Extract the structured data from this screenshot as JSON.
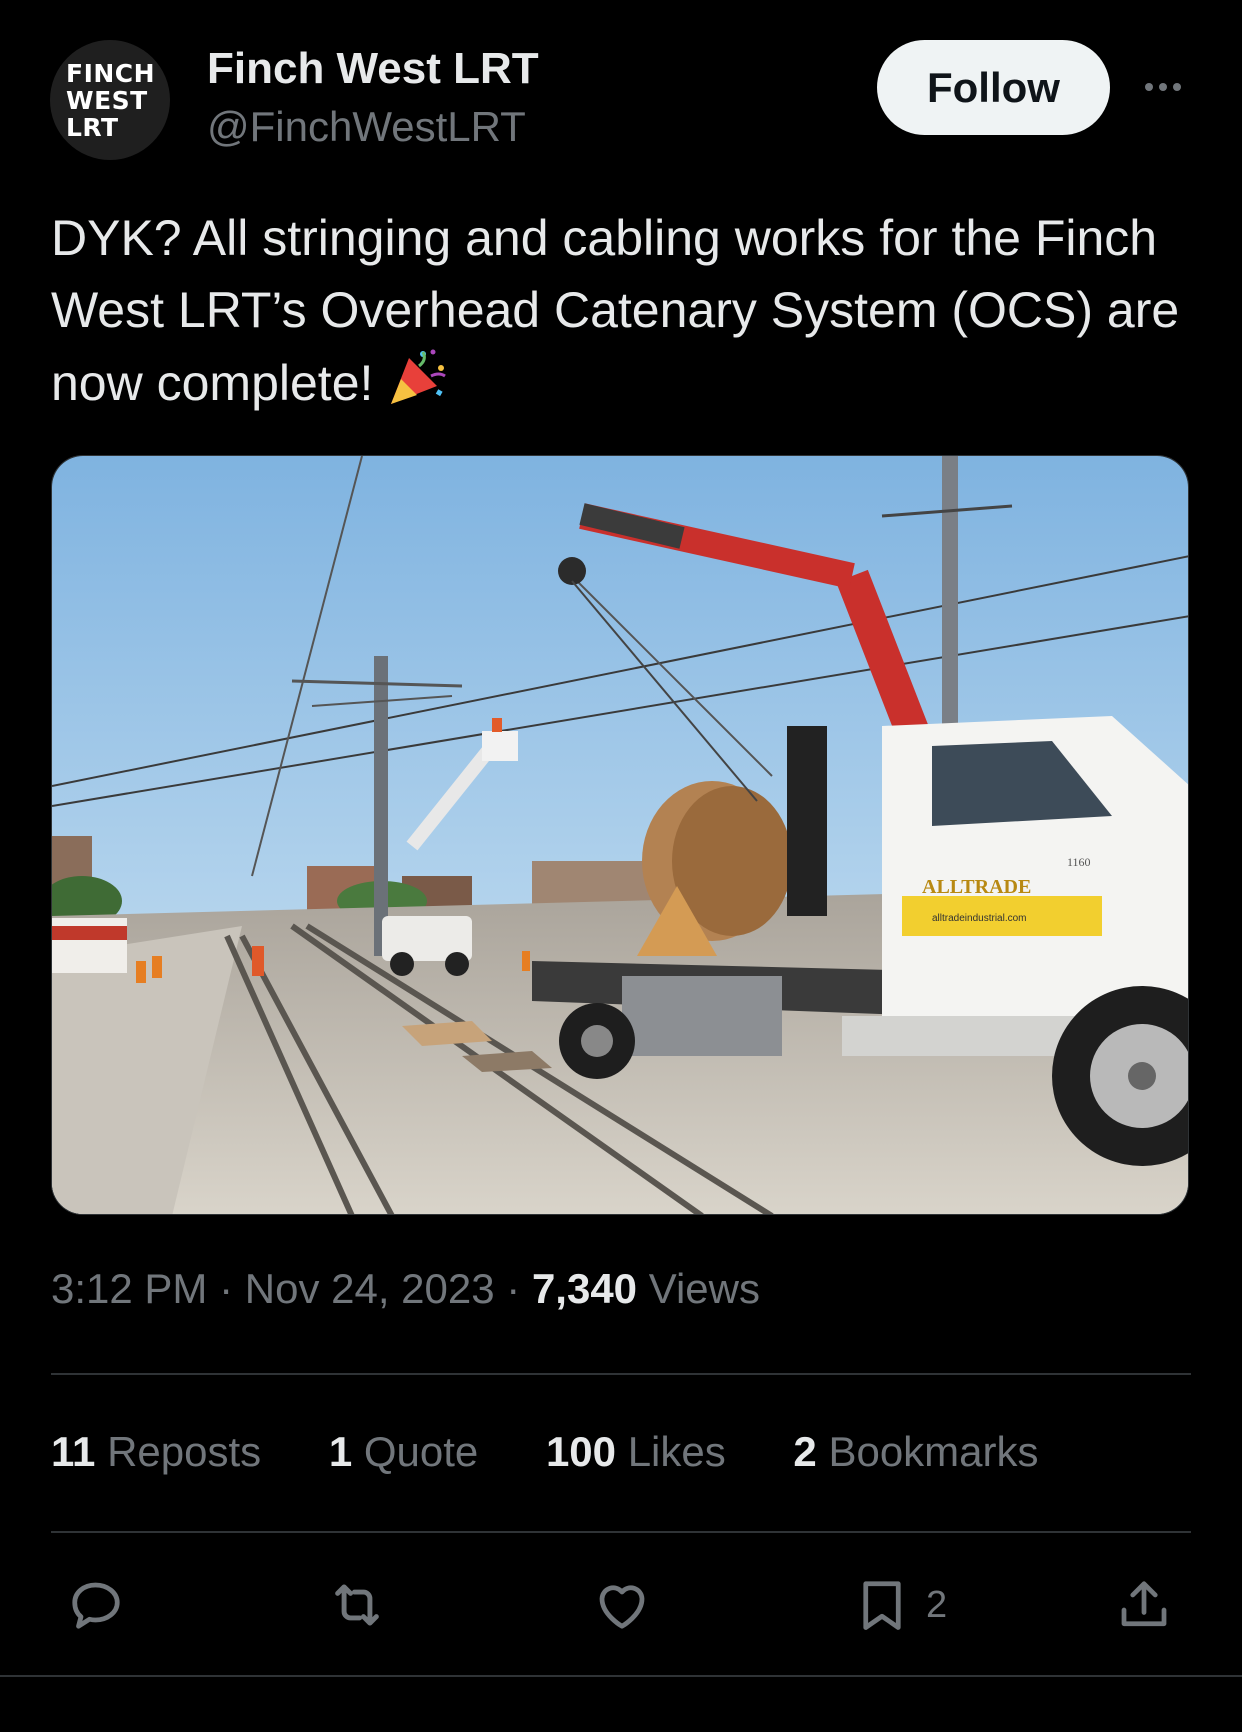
{
  "profile": {
    "avatar_lines": [
      "FINCH",
      "WEST",
      "LRT"
    ],
    "display_name": "Finch West LRT",
    "handle": "@FinchWestLRT"
  },
  "header": {
    "follow_label": "Follow",
    "more_icon": "more-icon"
  },
  "tweet": {
    "text": "DYK? All stringing and cabling works for the Finch West LRT’s Overhead Catenary System (OCS) are now complete!",
    "emoji": "party-popper-icon"
  },
  "media": {
    "truck_brand": "ALLTRADE",
    "truck_url": "alltradeindustrial.com",
    "truck_number": "1160"
  },
  "meta": {
    "time": "3:12 PM",
    "sep": " · ",
    "date": "Nov 24, 2023",
    "views_count": "7,340",
    "views_label": " Views"
  },
  "stats": {
    "reposts": {
      "count": "11",
      "label": " Reposts"
    },
    "quotes": {
      "count": "1",
      "label": " Quote"
    },
    "likes": {
      "count": "100",
      "label": " Likes"
    },
    "bookmarks": {
      "count": "2",
      "label": " Bookmarks"
    }
  },
  "actions": {
    "reply_icon": "reply-icon",
    "repost_icon": "repost-icon",
    "like_icon": "heart-icon",
    "bookmark_icon": "bookmark-icon",
    "bookmark_count": "2",
    "share_icon": "share-icon"
  },
  "colors": {
    "background": "#000000",
    "text": "#e7e9ea",
    "muted": "#71767b",
    "divider": "#2f3336",
    "follow_bg": "#eff3f4"
  }
}
